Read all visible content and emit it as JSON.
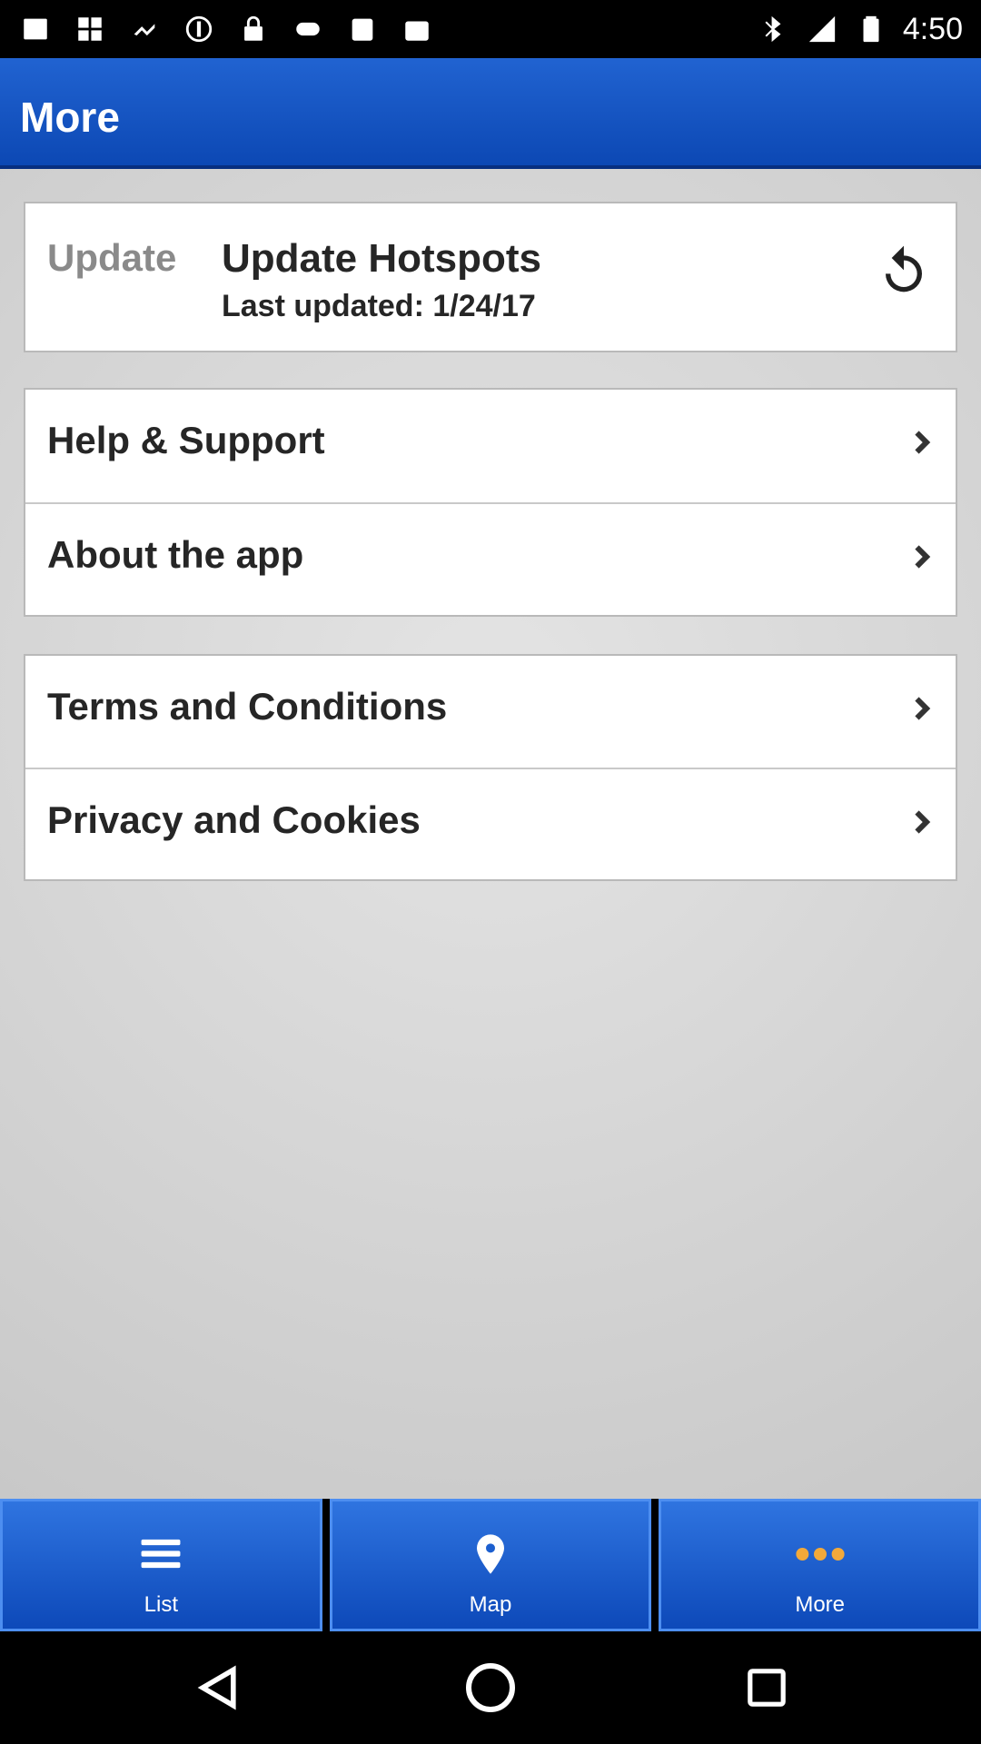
{
  "status_bar": {
    "time": "4:50",
    "icons": [
      "bluetooth-icon",
      "signal-icon",
      "battery-icon"
    ]
  },
  "app_bar": {
    "title": "More"
  },
  "update_card": {
    "label": "Update",
    "title": "Update Hotspots",
    "subtitle": "Last updated: 1/24/17",
    "action_icon": "refresh-icon"
  },
  "menu": {
    "group2": [
      {
        "label": "Help & Support"
      },
      {
        "label": "About the app"
      }
    ],
    "group3": [
      {
        "label": "Terms and Conditions"
      },
      {
        "label": "Privacy and Cookies"
      }
    ]
  },
  "bottom_nav": {
    "tabs": [
      {
        "label": "List",
        "icon": "list-icon"
      },
      {
        "label": "Map",
        "icon": "map-pin-icon"
      },
      {
        "label": "More",
        "icon": "more-dots-icon"
      }
    ]
  },
  "colors": {
    "accent": "#0d49b9",
    "background": "#d6d6d6"
  }
}
